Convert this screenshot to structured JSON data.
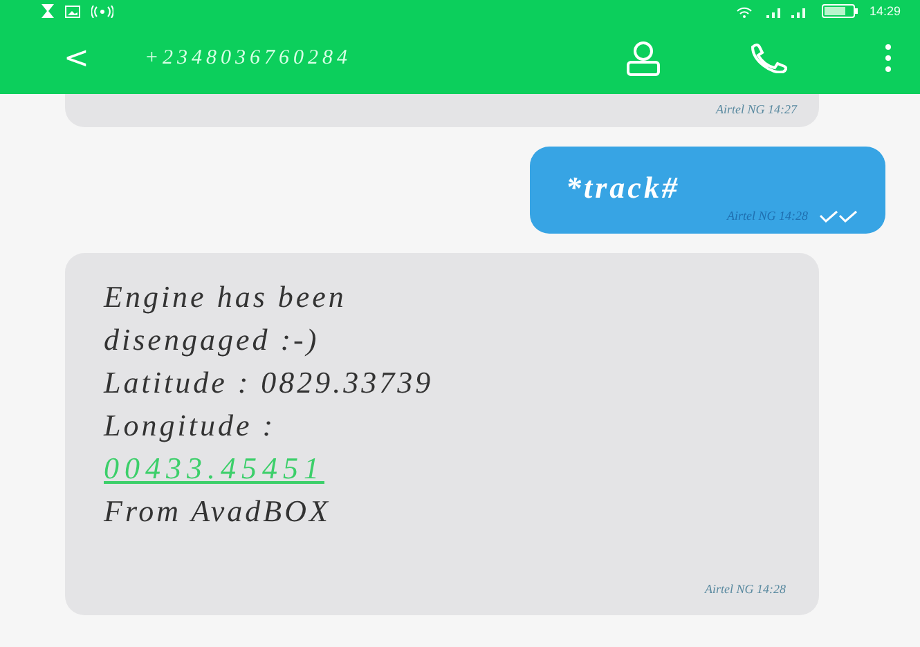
{
  "status_bar": {
    "time": "14:29"
  },
  "header": {
    "back": "<",
    "contact": "+2348036760284"
  },
  "messages": [
    {
      "kind": "received",
      "partial": true,
      "sender": "Airtel NG",
      "time": "14:27"
    },
    {
      "kind": "sent",
      "lines": [
        "*track#"
      ],
      "sender": "Airtel NG",
      "time": "14:28",
      "delivered": true
    },
    {
      "kind": "received",
      "lines": [
        "Engine has been",
        "disengaged :-)",
        "Latitude : 0829.33739",
        "Longitude :"
      ],
      "link": "00433.45451",
      "footer": "From AvadBOX",
      "sender": "Airtel NG",
      "time": "14:28"
    }
  ]
}
